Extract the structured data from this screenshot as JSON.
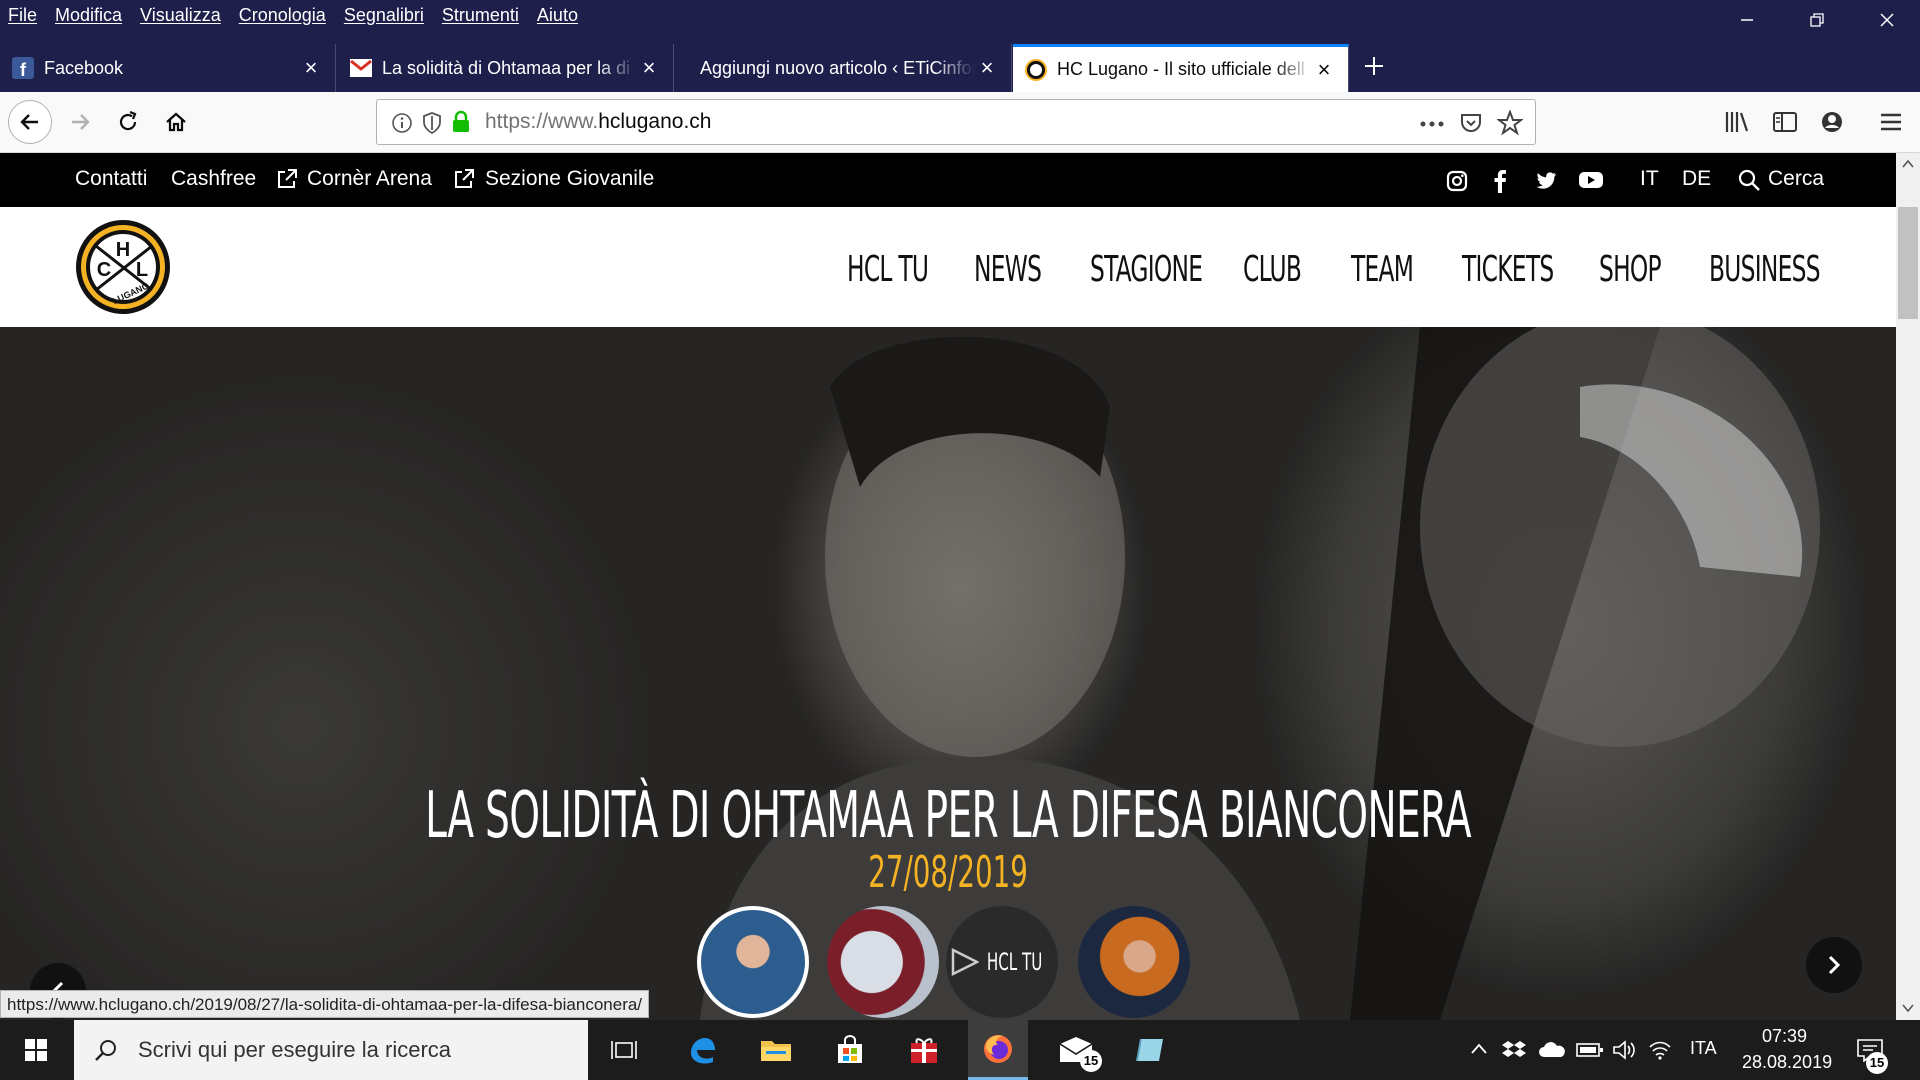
{
  "menu": [
    "File",
    "Modifica",
    "Visualizza",
    "Cronologia",
    "Segnalibri",
    "Strumenti",
    "Aiuto"
  ],
  "tabs": [
    {
      "label": "Facebook",
      "icon": "facebook-icon"
    },
    {
      "label": "La solidità di Ohtamaa per la di",
      "icon": "gmail-icon"
    },
    {
      "label": "Aggiungi nuovo articolo ‹ ETiCinfor",
      "icon": "none"
    },
    {
      "label": "HC Lugano - Il sito ufficiale dell",
      "icon": "hcl-icon",
      "active": true
    }
  ],
  "url": {
    "prefix": "https://www.",
    "domain": "hclugano.ch"
  },
  "site": {
    "topbar": {
      "links": [
        "Contatti",
        "Cashfree",
        "Cornèr Arena",
        "Sezione Giovanile"
      ],
      "languages": [
        "IT",
        "DE"
      ],
      "search": "Cerca"
    },
    "logo_letters": {
      "h": "H",
      "c": "C",
      "l": "L",
      "sub": "LUGANO"
    },
    "nav": [
      "HCL TU",
      "NEWS",
      "STAGIONE",
      "CLUB",
      "TEAM",
      "TICKETS",
      "SHOP",
      "BUSINESS"
    ],
    "hero": {
      "title": "LA SOLIDITÀ DI OHTAMAA PER LA DIFESA BIANCONERA",
      "date": "27/08/2019",
      "thumb_hcltu": "HCL TU"
    }
  },
  "status_url": "https://www.hclugano.ch/2019/08/27/la-solidita-di-ohtamaa-per-la-difesa-bianconera/",
  "taskbar": {
    "search_placeholder": "Scrivi qui per eseguire la ricerca",
    "mail_badge": "15",
    "lang": "ITA",
    "time": "07:39",
    "date": "28.08.2019",
    "notif_badge": "15"
  },
  "colors": {
    "titlebar": "#1e1f4b",
    "accent": "#f5b324",
    "tab_highlight": "#0a84ff"
  }
}
